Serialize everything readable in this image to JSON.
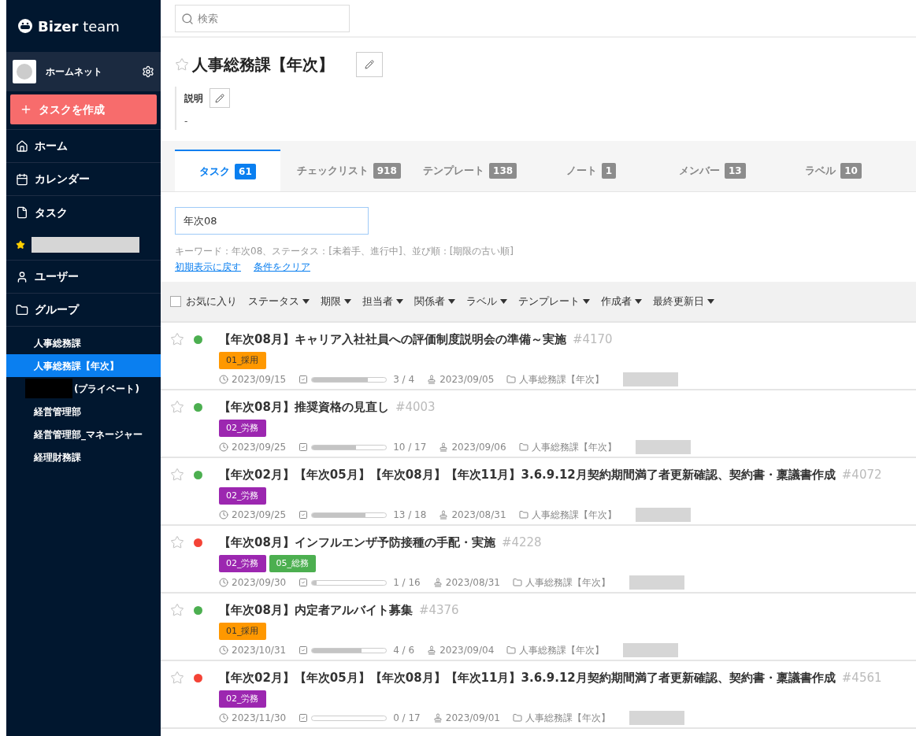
{
  "sidebar": {
    "logo": {
      "brand": "Bizer",
      "suffix": "team"
    },
    "account": {
      "name": "ホームネット"
    },
    "create_button": "タスクを作成",
    "nav": [
      {
        "kind": "home",
        "label": "ホーム"
      },
      {
        "kind": "calendar",
        "label": "カレンダー"
      },
      {
        "kind": "task",
        "label": "タスク"
      },
      {
        "kind": "favorite"
      },
      {
        "kind": "user",
        "label": "ユーザー"
      },
      {
        "kind": "group",
        "label": "グループ"
      }
    ],
    "groups": [
      {
        "label": "人事総務課",
        "selected": false,
        "redacted": false
      },
      {
        "label": "人事総務課【年次】",
        "selected": true,
        "redacted": false
      },
      {
        "label": "(プライベート)",
        "selected": false,
        "redacted": true
      },
      {
        "label": "経営管理部",
        "selected": false,
        "redacted": false
      },
      {
        "label": "経営管理部_マネージャー",
        "selected": false,
        "redacted": false
      },
      {
        "label": "経理財務課",
        "selected": false,
        "redacted": false
      }
    ]
  },
  "search": {
    "placeholder": "検索"
  },
  "header": {
    "title": "人事総務課【年次】",
    "favorite": false,
    "description_label": "説明",
    "description": "-"
  },
  "tabs": [
    {
      "label": "タスク",
      "count": "61",
      "selected": true
    },
    {
      "label": "チェックリスト",
      "count": "918",
      "selected": false
    },
    {
      "label": "テンプレート",
      "count": "138",
      "selected": false
    },
    {
      "label": "ノート",
      "count": "1",
      "selected": false
    },
    {
      "label": "メンバー",
      "count": "13",
      "selected": false
    },
    {
      "label": "ラベル",
      "count": "10",
      "selected": false
    }
  ],
  "filter": {
    "value": "年次08",
    "summary": "キーワード：年次08、ステータス：[未着手、進行中]、並び順：[期限の古い順]",
    "links": [
      "初期表示に戻す",
      "条件をクリア"
    ]
  },
  "toolbar": {
    "favorites": {
      "label": "お気に入り",
      "checked": false
    },
    "dropdowns": [
      "ステータス",
      "期限",
      "担当者",
      "関係者",
      "ラベル",
      "テンプレート",
      "作成者",
      "最終更新日"
    ]
  },
  "tasks": [
    {
      "favorite": false,
      "color": "#4caf50",
      "title": "【年次08月】キャリア入社社員への評価制度説明会の準備～実施",
      "id": "#4170",
      "tags": [
        {
          "label": "01_採用",
          "color": "#ff9800"
        }
      ],
      "due": "2023/09/15",
      "level": 0.75,
      "progress": "3 / 4",
      "start": "2023/09/05",
      "group": "人事総務課【年次】"
    },
    {
      "favorite": false,
      "color": "#4caf50",
      "title": "【年次08月】推奨資格の見直し",
      "id": "#4003",
      "tags": [
        {
          "label": "02_労務",
          "color": "#9c27b0"
        }
      ],
      "due": "2023/09/25",
      "level": 0.59,
      "progress": "10 / 17",
      "start": "2023/09/06",
      "group": "人事総務課【年次】"
    },
    {
      "favorite": false,
      "color": "#4caf50",
      "title": "【年次02月】【年次05月】【年次08月】【年次11月】3.6.9.12月契約期間満了者更新確認、契約書・稟議書作成",
      "id": "#4072",
      "tags": [
        {
          "label": "02_労務",
          "color": "#9c27b0"
        }
      ],
      "due": "2023/09/25",
      "level": 0.72,
      "progress": "13 / 18",
      "start": "2023/08/31",
      "group": "人事総務課【年次】"
    },
    {
      "favorite": false,
      "color": "#f44336",
      "title": "【年次08月】インフルエンザ予防接種の手配・実施",
      "id": "#4228",
      "tags": [
        {
          "label": "02_労務",
          "color": "#9c27b0"
        },
        {
          "label": "05_総務",
          "color": "#4caf50"
        }
      ],
      "due": "2023/09/30",
      "level": 0.06,
      "progress": "1 / 16",
      "start": "2023/08/31",
      "group": "人事総務課【年次】"
    },
    {
      "favorite": false,
      "color": "#4caf50",
      "title": "【年次08月】内定者アルバイト募集",
      "id": "#4376",
      "tags": [
        {
          "label": "01_採用",
          "color": "#ff9800"
        }
      ],
      "due": "2023/10/31",
      "level": 0.67,
      "progress": "4 / 6",
      "start": "2023/09/04",
      "group": "人事総務課【年次】"
    },
    {
      "favorite": false,
      "color": "#f44336",
      "title": "【年次02月】【年次05月】【年次08月】【年次11月】3.6.9.12月契約期間満了者更新確認、契約書・稟議書作成",
      "id": "#4561",
      "tags": [
        {
          "label": "02_労務",
          "color": "#9c27b0"
        }
      ],
      "due": "2023/11/30",
      "level": 0,
      "progress": "0 / 17",
      "start": "2023/09/01",
      "group": "人事総務課【年次】"
    }
  ]
}
